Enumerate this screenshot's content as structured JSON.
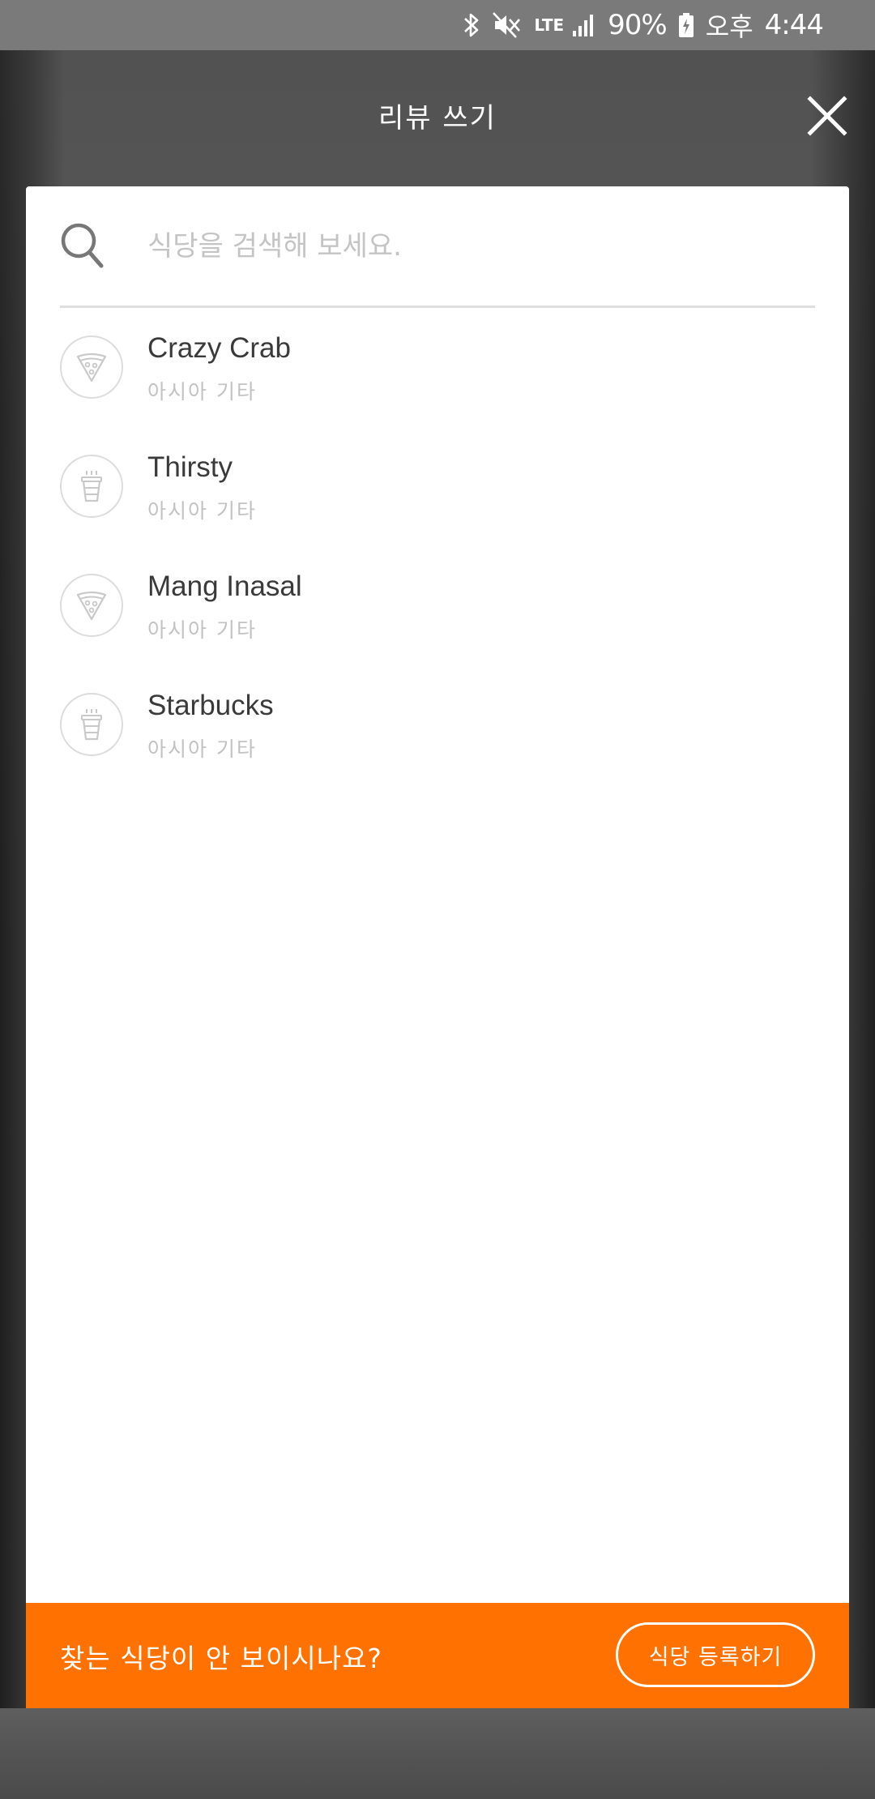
{
  "status_bar": {
    "battery": "90%",
    "ampm": "오후",
    "time": "4:44",
    "network": "LTE"
  },
  "header": {
    "title": "리뷰 쓰기",
    "close_icon": "close-icon"
  },
  "search": {
    "placeholder": "식당을 검색해 보세요.",
    "value": "",
    "icon": "search-icon"
  },
  "restaurants": [
    {
      "name": "Crazy Crab",
      "category": "아시아 기타",
      "icon": "pizza-icon"
    },
    {
      "name": "Thirsty",
      "category": "아시아 기타",
      "icon": "cup-icon"
    },
    {
      "name": "Mang Inasal",
      "category": "아시아 기타",
      "icon": "pizza-icon"
    },
    {
      "name": "Starbucks",
      "category": "아시아 기타",
      "icon": "cup-icon"
    }
  ],
  "footer": {
    "prompt": "찾는 식당이 안 보이시나요?",
    "register_label": "식당 등록하기",
    "accent_color": "#ff7100"
  }
}
